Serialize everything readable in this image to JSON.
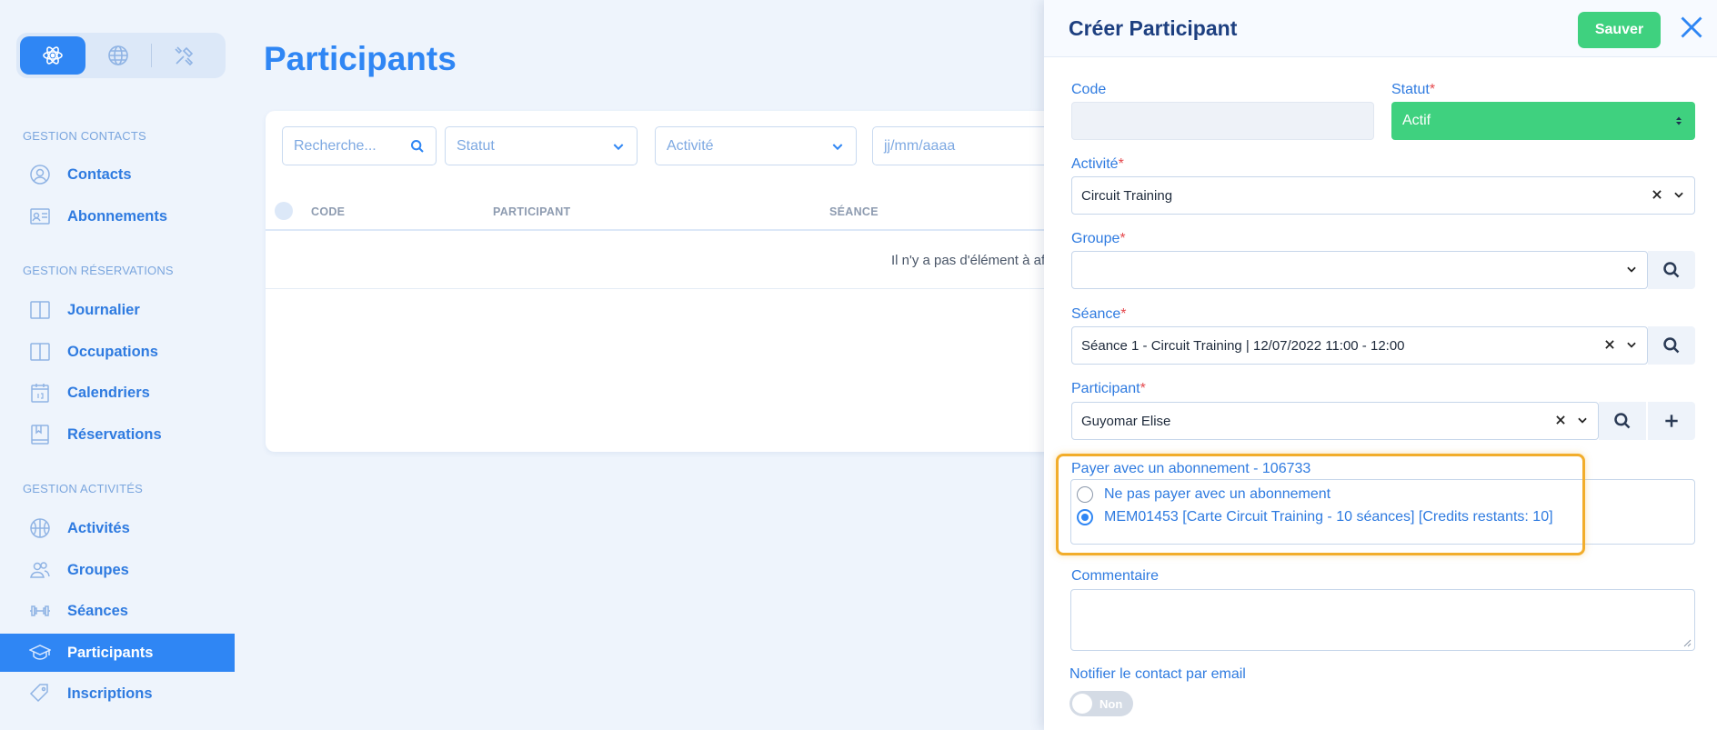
{
  "sidebar": {
    "sections": [
      {
        "title": "GESTION CONTACTS",
        "items": [
          {
            "label": "Contacts",
            "icon": "user-circle-icon"
          },
          {
            "label": "Abonnements",
            "icon": "id-card-icon"
          }
        ]
      },
      {
        "title": "GESTION RÉSERVATIONS",
        "items": [
          {
            "label": "Journalier",
            "icon": "book-open-icon"
          },
          {
            "label": "Occupations",
            "icon": "book-open-icon"
          },
          {
            "label": "Calendriers",
            "icon": "calendar-icon"
          },
          {
            "label": "Réservations",
            "icon": "bookmark-book-icon"
          }
        ]
      },
      {
        "title": "GESTION ACTIVITÉS",
        "items": [
          {
            "label": "Activités",
            "icon": "ball-icon"
          },
          {
            "label": "Groupes",
            "icon": "users-icon"
          },
          {
            "label": "Séances",
            "icon": "dumbbell-icon"
          },
          {
            "label": "Participants",
            "icon": "graduation-cap-icon",
            "active": true
          },
          {
            "label": "Inscriptions",
            "icon": "tag-icon"
          }
        ]
      }
    ]
  },
  "main": {
    "title": "Participants",
    "filters": {
      "search_placeholder": "Recherche...",
      "status": "Statut",
      "activity": "Activité",
      "date_placeholder": "jj/mm/aaaa"
    },
    "columns": [
      "CODE",
      "PARTICIPANT",
      "SÉANCE"
    ],
    "empty_text": "Il n'y a pas d'élément à affic"
  },
  "panel": {
    "title": "Créer Participant",
    "save_label": "Sauver",
    "fields": {
      "code_label": "Code",
      "code_value": "",
      "status_label": "Statut",
      "status_value": "Actif",
      "activity_label": "Activité",
      "activity_value": "Circuit Training",
      "group_label": "Groupe",
      "group_value": "",
      "session_label": "Séance",
      "session_value": "Séance 1 - Circuit Training | 12/07/2022 11:00 - 12:00",
      "participant_label": "Participant",
      "participant_value": "Guyomar Elise",
      "subscription_label": "Payer avec un abonnement - 106733",
      "subscription_options": [
        "Ne pas payer avec un abonnement",
        "MEM01453 [Carte Circuit Training - 10 séances] [Credits restants: 10]"
      ],
      "subscription_selected": 1,
      "comment_label": "Commentaire",
      "notify_label": "Notifier le contact par email",
      "notify_value": "Non"
    },
    "required_mark": "*"
  },
  "colors": {
    "accent": "#2f86f4",
    "success": "#3fd17f",
    "highlight": "#f2ad2b",
    "danger": "#e5484d"
  }
}
